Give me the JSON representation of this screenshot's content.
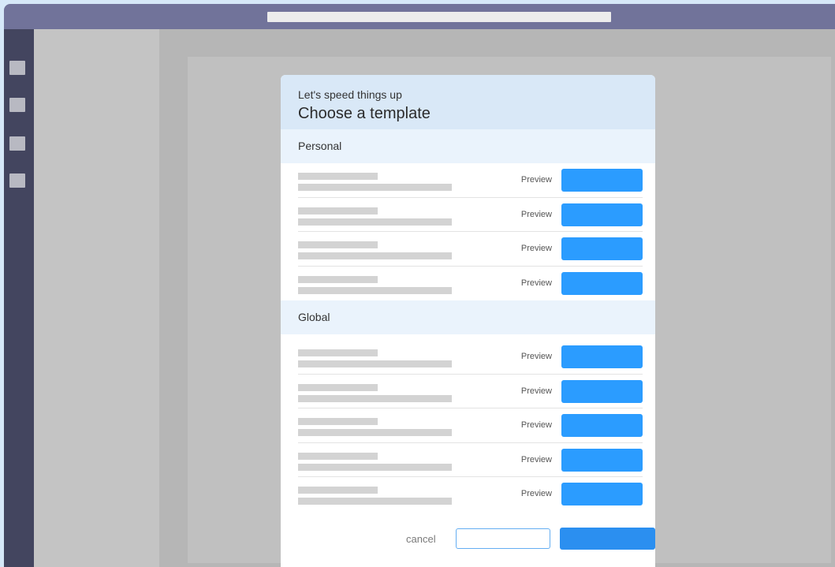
{
  "dialog": {
    "subtitle": "Let's speed things up",
    "title": "Choose a template"
  },
  "sections": {
    "personal": {
      "label": "Personal",
      "rows": [
        {
          "preview_label": "Preview"
        },
        {
          "preview_label": "Preview"
        },
        {
          "preview_label": "Preview"
        },
        {
          "preview_label": "Preview"
        }
      ]
    },
    "global": {
      "label": "Global",
      "rows": [
        {
          "preview_label": "Preview"
        },
        {
          "preview_label": "Preview"
        },
        {
          "preview_label": "Preview"
        },
        {
          "preview_label": "Preview"
        },
        {
          "preview_label": "Preview"
        }
      ]
    }
  },
  "footer": {
    "cancel_label": "cancel"
  },
  "colors": {
    "titlebar": "#71739a",
    "sidebar": "#43455f",
    "accent": "#2b9cff",
    "primary": "#2b8ff0",
    "header_bg": "#d9e8f7",
    "section_bg": "#eaf3fc"
  }
}
